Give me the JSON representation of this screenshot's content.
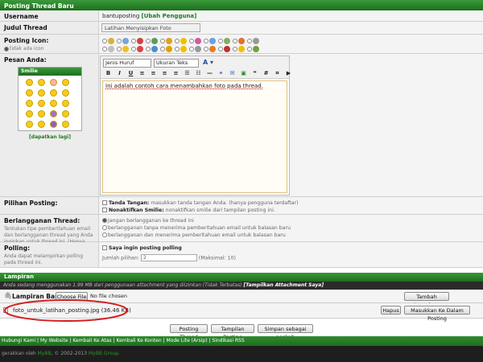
{
  "header": {
    "title": "Posting Thread Baru"
  },
  "username": {
    "label": "Username",
    "value": "bantuposting",
    "change_link": "[Ubah Pengguna]"
  },
  "thread_title": {
    "label": "Judul Thread",
    "value": "Latihan Menyisipkan Foto"
  },
  "post_icon": {
    "label": "Posting Icon:",
    "no_icon": "tidak ada icon",
    "icon_colors": [
      "#d8b23a",
      "#7aa3d6",
      "#c44",
      "#57a05a",
      "#e0a020",
      "#f0c000",
      "#cf5ba0",
      "#6aa0e0",
      "#8a6",
      "#e07030",
      "#999",
      "#c0c0c0",
      "#f0c020",
      "#d44",
      "#4a8fd0",
      "#e0a000",
      "#f0c000",
      "#999",
      "#e87a20",
      "#c03030",
      "#f0c000",
      "#70a040",
      "#e0c000",
      "#40a0d0",
      "#e04040",
      "#a060c0",
      "#f0c000",
      "#707070",
      "#50a050",
      "#e0a020",
      "#f0c000",
      "#d07020"
    ]
  },
  "message": {
    "label": "Pesan Anda:",
    "font_select": "Jenis Huruf",
    "size_select": "Ukuran Teks",
    "text": "Ini adalah contoh cara menambahkan foto pada thread."
  },
  "smilies": {
    "title": "Smilie",
    "more_link": "[dapatkan lagi]",
    "colors": [
      "#f6cc1a",
      "#f6cc1a",
      "#ffb0b0",
      "#f6cc1a",
      "#f6cc1a",
      "#f6cc1a",
      "#f6cc1a",
      "#f6cc1a",
      "#f6cc1a",
      "#f6cc1a",
      "#f6cc1a",
      "#f6cc1a",
      "#f6cc1a",
      "#f6cc1a",
      "#a070d0",
      "#f6cc1a",
      "#f6cc1a",
      "#f6cc1a",
      "#9060c0",
      "#f6cc1a"
    ]
  },
  "post_options": {
    "label": "Pilihan Posting:",
    "signature_title": "Tanda Tangan:",
    "signature_text": "masukkan tanda tangan Anda. (hanya pengguna terdaftar)",
    "smilies_title": "Nonaktifkan Smilie:",
    "smilies_text": "nonaktifkan smilie dari tampilan posting ini."
  },
  "subscription": {
    "label": "Berlangganan Thread:",
    "desc": "Tentukan tipe pemberitahuan email dan berlangganan thread yang Anda inginkan untuk thread ini. (Hanya pengguna terdaftar)",
    "opt1": "Jangan berlangganan ke thread ini",
    "opt2": "berlangganan tanpa menerima pemberitahuan email untuk balasan baru",
    "opt3": "berlangganan dan menerima pemberitahuan email untuk balasan baru"
  },
  "polling": {
    "label": "Polling:",
    "desc": "Anda dapat melampirkan polling pada thread ini.",
    "check_text": "Saya ingin posting polling",
    "options_label": "Jumlah pilihan:",
    "options_value": "2",
    "max_text": "(Maksimal: 10)"
  },
  "attachments": {
    "title": "Lampiran",
    "usage_text": "Anda sedang menggunakan 1.99 MB dari penggunaan attachment yang diizinkan (Tidak Terbatas)",
    "view_link": "[Tampilkan Attachment Saya]",
    "new_label": "Lampiran Baru:",
    "choose_btn": "Choose File",
    "no_file": "No file chosen",
    "add_btn": "Tambah Lampiran",
    "file_name": "foto_untuk_latihan_posting.jpg (36.46 KB)",
    "delete_btn": "Hapus",
    "insert_btn": "Masukkan Ke Dalam Posting"
  },
  "actions": {
    "post": "Posting Thread",
    "preview": "Tampilan Posting",
    "draft": "Simpan sebagai naskah"
  },
  "footer": {
    "links": [
      "Hubungi Kami",
      "My Website",
      "Kembali Ke Atas",
      "Kembali Ke Konten",
      "Mode Lite (Arsip)",
      "Sindikasi RSS"
    ],
    "powered_prefix": "gerakkan oleh",
    "powered_brand": "MyBB",
    "powered_mid": ", © 2002-2013",
    "powered_group": "MyBB Group."
  },
  "colors": {
    "brand_green": "#2a7d2a",
    "dark_bar": "#2b2b2b",
    "highlight_red": "#d42020"
  }
}
